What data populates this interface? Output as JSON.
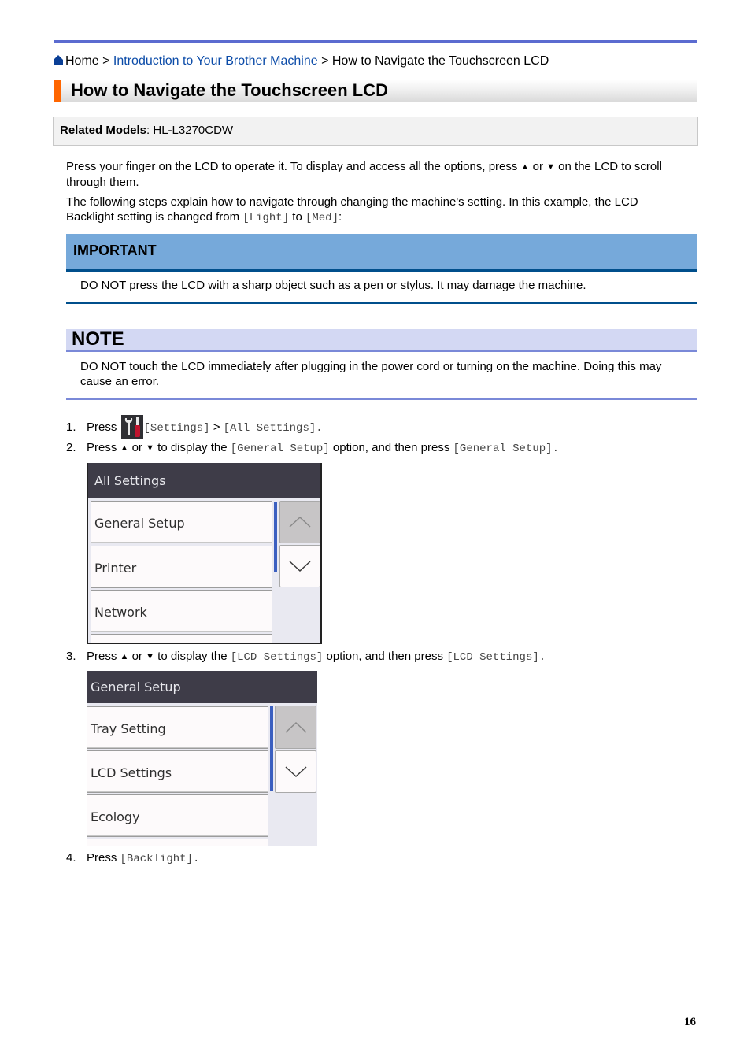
{
  "breadcrumb": {
    "home": "Home",
    "sep1": " > ",
    "link": "Introduction to Your Brother Machine",
    "sep2": " > ",
    "current": "How to Navigate the Touchscreen LCD"
  },
  "title": "How to Navigate the Touchscreen LCD",
  "related": {
    "label": "Related Models",
    "sep": ": ",
    "value": "HL-L3270CDW"
  },
  "intro": {
    "p1_a": "Press your finger on the LCD to operate it. To display and access all the options, press ",
    "up": "▲",
    "or": " or ",
    "down": "▼",
    "p1_b": " on the LCD to scroll through them.",
    "p2_a": "The following steps explain how to navigate through changing the machine's setting. In this example, the LCD Backlight setting is changed from ",
    "from": "[Light]",
    "to_word": " to ",
    "to": "[Med]",
    "p2_end": ":"
  },
  "important": {
    "heading": "IMPORTANT",
    "text": "DO NOT press the LCD with a sharp object such as a pen or stylus. It may damage the machine."
  },
  "note": {
    "heading": "NOTE",
    "text": "DO NOT touch the LCD immediately after plugging in the power cord or turning on the machine. Doing this may cause an error."
  },
  "steps": [
    {
      "num": "1.",
      "press": "Press ",
      "icon": "settings-icon",
      "a": "[Settings]",
      "mid": " > ",
      "b": "[All Settings]",
      "end": "."
    },
    {
      "num": "2.",
      "press": "Press ",
      "up": "▲",
      "or": " or ",
      "down": "▼",
      "mid1": " to display the ",
      "a": "[General Setup]",
      "mid2": " option, and then press ",
      "b": "[General Setup]",
      "end": "."
    },
    {
      "num": "3.",
      "press": "Press ",
      "up": "▲",
      "or": " or ",
      "down": "▼",
      "mid1": " to display the ",
      "a": "[LCD Settings]",
      "mid2": " option, and then press ",
      "b": "[LCD Settings]",
      "end": "."
    },
    {
      "num": "4.",
      "press": "Press ",
      "a": "[Backlight]",
      "end": "."
    }
  ],
  "lcd1": {
    "header": "All Settings",
    "items": [
      "General Setup",
      "Printer",
      "Network"
    ]
  },
  "lcd2": {
    "header": "General Setup",
    "items": [
      "Tray Setting",
      "LCD Settings",
      "Ecology"
    ]
  },
  "page_number": "16"
}
